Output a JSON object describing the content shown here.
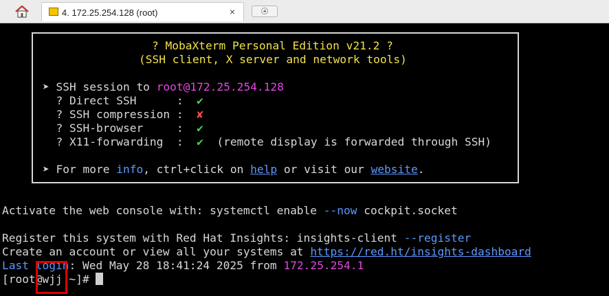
{
  "tab": {
    "label": "4. 172.25.254.128 (root)",
    "close": "×"
  },
  "banner": {
    "title": "? MobaXterm Personal Edition v21.2 ?",
    "subtitle": "(SSH client, X server and network tools)",
    "session_prefix": "➤ SSH session to ",
    "session_target": "root@172.25.254.128",
    "options": [
      {
        "label": "  ? Direct SSH      :  ",
        "mark": "✔",
        "note": ""
      },
      {
        "label": "  ? SSH compression :  ",
        "mark": "✘",
        "note": ""
      },
      {
        "label": "  ? SSH-browser     :  ",
        "mark": "✔",
        "note": ""
      },
      {
        "label": "  ? X11-forwarding  :  ",
        "mark": "✔",
        "note": "  (remote display is forwarded through SSH)"
      }
    ],
    "more": {
      "prefix": "➤ For more ",
      "info": "info",
      "middle1": ", ctrl+click on ",
      "help": "help",
      "middle2": " or visit our ",
      "website": "website",
      "suffix": "."
    }
  },
  "console": {
    "activate_prefix": "Activate the web console with: systemctl enable ",
    "activate_flag": "--now",
    "activate_suffix": " cockpit.socket",
    "register_prefix": "Register this system with Red Hat Insights: insights-client ",
    "register_flag": "--register",
    "create_prefix": "Create an account or view all your systems at ",
    "create_url": "https://red.ht/insights-dashboard",
    "lastlogin_label": "Last login",
    "lastlogin_text": ": Wed May 28 18:41:24 2025 from ",
    "lastlogin_ip": "172.25.254.1",
    "prompt": "[root@wjj ~]# "
  },
  "colors": {
    "check": "#4bd64b",
    "cross": "#ff4b4b",
    "accent_blue": "#5d98ff",
    "magenta": "#e347e3",
    "yellow": "#f2e24b",
    "annotation_red": "#e00000"
  }
}
